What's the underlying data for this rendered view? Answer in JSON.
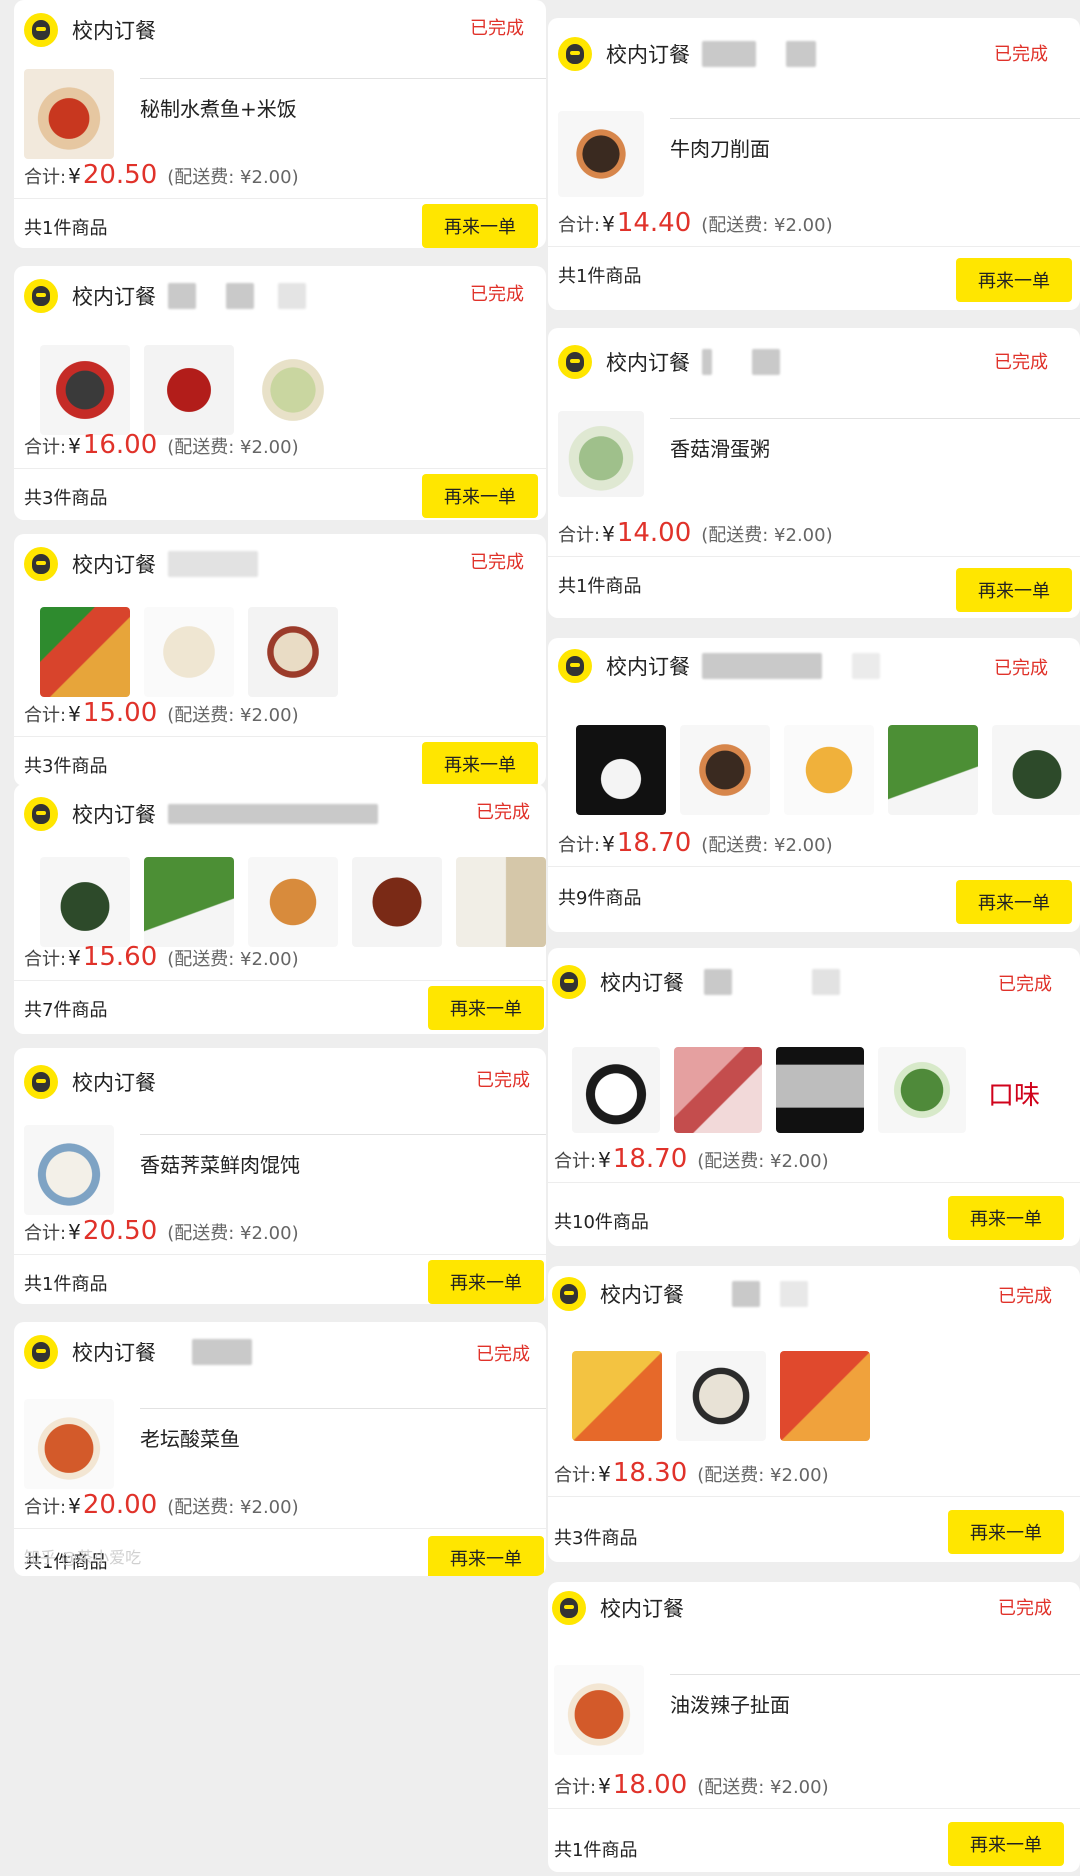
{
  "common": {
    "shop_name": "校内订餐",
    "status": "已完成",
    "total_label": "合计:",
    "currency": "¥",
    "delivery_fee": "(配送费: ¥2.00)",
    "reorder_label": "再来一单"
  },
  "left": [
    {
      "amount": "20.50",
      "count": "共1件商品",
      "item_name": "秘制水煮鱼+米饭",
      "thumbs": [
        "fish-dish"
      ]
    },
    {
      "amount": "16.00",
      "count": "共3件商品",
      "item_name": "",
      "thumbs": [
        "spicy-meat",
        "spicy-meat",
        "wonton-soup"
      ]
    },
    {
      "amount": "15.00",
      "count": "共3件商品",
      "item_name": "",
      "thumbs": [
        "chili-bowls",
        "dumplings",
        "dumplings-sauce"
      ]
    },
    {
      "amount": "15.60",
      "count": "共7件商品",
      "item_name": "",
      "thumbs": [
        "seaweed",
        "bok-choy",
        "shredded-potato",
        "braised-meat",
        "noodles"
      ]
    },
    {
      "amount": "20.50",
      "count": "共1件商品",
      "item_name": "香菇荠菜鲜肉馄饨",
      "thumbs": [
        "wonton"
      ]
    },
    {
      "amount": "20.00",
      "count": "共1件商品",
      "item_name": "老坛酸菜鱼",
      "thumbs": [
        "pickled-fish"
      ]
    }
  ],
  "right": [
    {
      "amount": "14.40",
      "count": "共1件商品",
      "item_name": "牛肉刀削面",
      "thumbs": [
        "beef-noodles"
      ]
    },
    {
      "amount": "14.00",
      "count": "共1件商品",
      "item_name": "香菇滑蛋粥",
      "thumbs": [
        "congee"
      ]
    },
    {
      "amount": "18.70",
      "count": "共9件商品",
      "item_name": "",
      "thumbs": [
        "rice",
        "wood-ear",
        "quail-eggs",
        "greens",
        "seaweed"
      ]
    },
    {
      "amount": "18.70",
      "count": "共10件商品",
      "item_name": "",
      "thumbs": [
        "rice-bowl",
        "pork",
        "container",
        "bok-choy",
        "flavor-logo"
      ]
    },
    {
      "amount": "18.30",
      "count": "共3件商品",
      "item_name": "",
      "thumbs": [
        "snack-packs",
        "dumplings",
        "sauce-packs"
      ]
    },
    {
      "amount": "18.00",
      "count": "共1件商品",
      "item_name": "油泼辣子扯面",
      "thumbs": [
        "chili-noodles"
      ]
    }
  ],
  "watermark": "知乎 @茶小爱吃"
}
